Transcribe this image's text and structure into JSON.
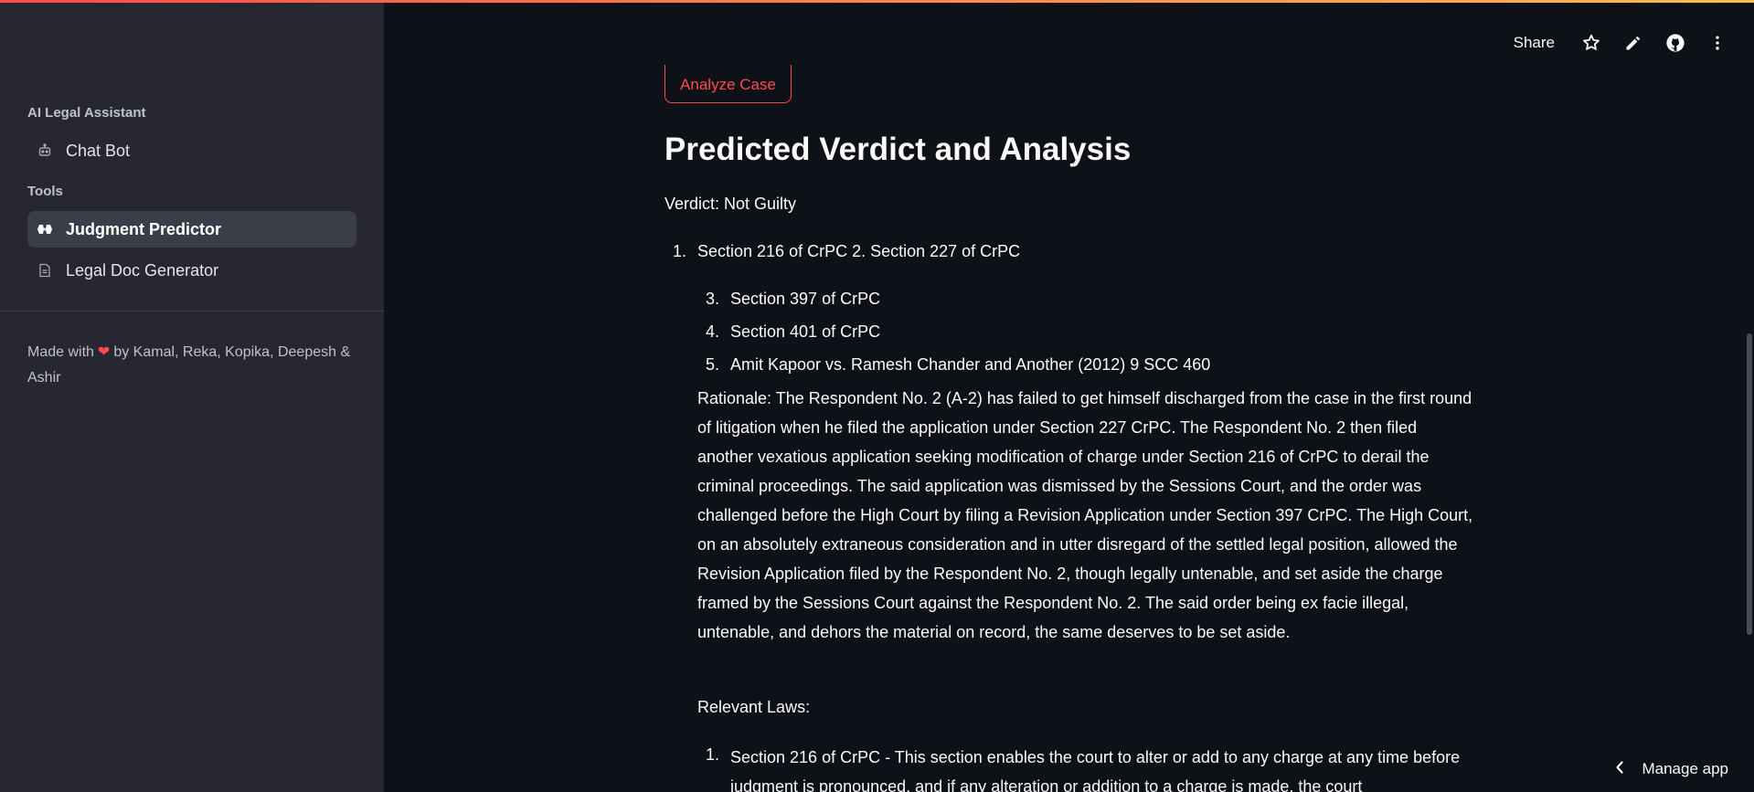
{
  "sidebar": {
    "section1_title": "AI Legal Assistant",
    "chat_bot": "Chat Bot",
    "section2_title": "Tools",
    "judgment_predictor": "Judgment Predictor",
    "legal_doc_generator": "Legal Doc Generator",
    "footer_prefix": "Made with",
    "footer_suffix": "by Kamal, Reka, Kopika, Deepesh & Ashir"
  },
  "toolbar": {
    "share": "Share"
  },
  "main": {
    "analyze_button": "Analyze Case",
    "heading": "Predicted Verdict and Analysis",
    "verdict": "Verdict: Not Guilty",
    "list": [
      {
        "num": "1.",
        "text": "Section 216 of CrPC 2. Section 227 of CrPC"
      },
      {
        "num": "3.",
        "text": "Section 397 of CrPC"
      },
      {
        "num": "4.",
        "text": "Section 401 of CrPC"
      },
      {
        "num": "5.",
        "text": "Amit Kapoor vs. Ramesh Chander and Another (2012) 9 SCC 460"
      }
    ],
    "rationale": "Rationale: The Respondent No. 2 (A-2) has failed to get himself discharged from the case in the first round of litigation when he filed the application under Section 227 CrPC. The Respondent No. 2 then filed another vexatious application seeking modification of charge under Section 216 of CrPC to derail the criminal proceedings. The said application was dismissed by the Sessions Court, and the order was challenged before the High Court by filing a Revision Application under Section 397 CrPC. The High Court, on an absolutely extraneous consideration and in utter disregard of the settled legal position, allowed the Revision Application filed by the Respondent No. 2, though legally untenable, and set aside the charge framed by the Sessions Court against the Respondent No. 2. The said order being ex facie illegal, untenable, and dehors the material on record, the same deserves to be set aside.",
    "relevant_laws_label": "Relevant Laws:",
    "law_num": "1.",
    "law_text": "Section 216 of CrPC - This section enables the court to alter or add to any charge at any time before judgment is pronounced, and if any alteration or addition to a charge is made, the court"
  },
  "manage_app": "Manage app",
  "colors": {
    "accent": "#ff4b4b",
    "background": "#0e1117",
    "sidebar": "#262730"
  },
  "icons": [
    "robot-icon",
    "gavel-icon",
    "document-icon",
    "heart-icon",
    "star-icon",
    "pencil-icon",
    "github-icon",
    "more-vertical-icon",
    "chevron-left-icon"
  ]
}
